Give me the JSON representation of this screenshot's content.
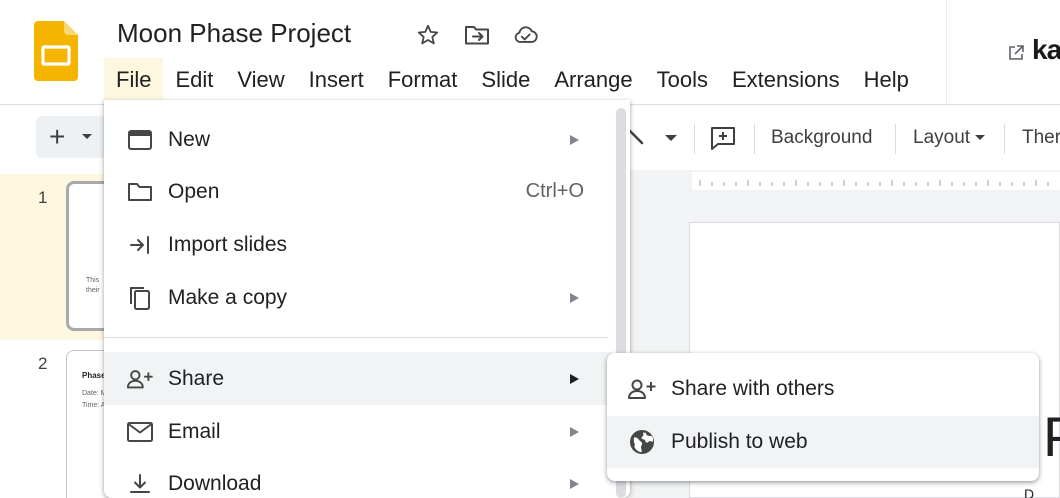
{
  "app": {
    "doc_title": "Moon Phase Project",
    "colors": {
      "accent": "#f4b400",
      "menu_active_bg": "#fef7e0",
      "hover_bg": "#f1f3f4"
    }
  },
  "header_icons": [
    "star-icon",
    "move-to-folder-icon",
    "cloud-saved-icon"
  ],
  "menubar": {
    "items": [
      "File",
      "Edit",
      "View",
      "Insert",
      "Format",
      "Slide",
      "Arrange",
      "Tools",
      "Extensions",
      "Help"
    ],
    "active": "File"
  },
  "extension": {
    "brand": "ka"
  },
  "toolbar": {
    "new_label": "+",
    "background_label": "Background",
    "layout_label": "Layout",
    "theme_label": "Ther"
  },
  "filmstrip": {
    "slides": [
      {
        "number": "1",
        "text_line1": "This",
        "text_line2": "their"
      },
      {
        "number": "2",
        "title": "Phase",
        "line1": "Date: M",
        "line2": "Time: A"
      }
    ]
  },
  "canvas": {
    "visible_glyph": "P",
    "visible_small": "D"
  },
  "file_menu": {
    "items": [
      {
        "label": "New",
        "icon": "slides-icon",
        "shortcut": "",
        "has_submenu": true
      },
      {
        "label": "Open",
        "icon": "folder-icon",
        "shortcut": "Ctrl+O",
        "has_submenu": false
      },
      {
        "label": "Import slides",
        "icon": "import-icon",
        "shortcut": "",
        "has_submenu": false
      },
      {
        "label": "Make a copy",
        "icon": "copy-icon",
        "shortcut": "",
        "has_submenu": true
      },
      {
        "label": "Share",
        "icon": "person-add-icon",
        "shortcut": "",
        "has_submenu": true
      },
      {
        "label": "Email",
        "icon": "mail-icon",
        "shortcut": "",
        "has_submenu": true
      },
      {
        "label": "Download",
        "icon": "download-icon",
        "shortcut": "",
        "has_submenu": true
      }
    ],
    "hovered": "Share"
  },
  "share_submenu": {
    "items": [
      {
        "label": "Share with others",
        "icon": "person-add-icon"
      },
      {
        "label": "Publish to web",
        "icon": "globe-icon"
      }
    ],
    "hovered": "Publish to web"
  }
}
